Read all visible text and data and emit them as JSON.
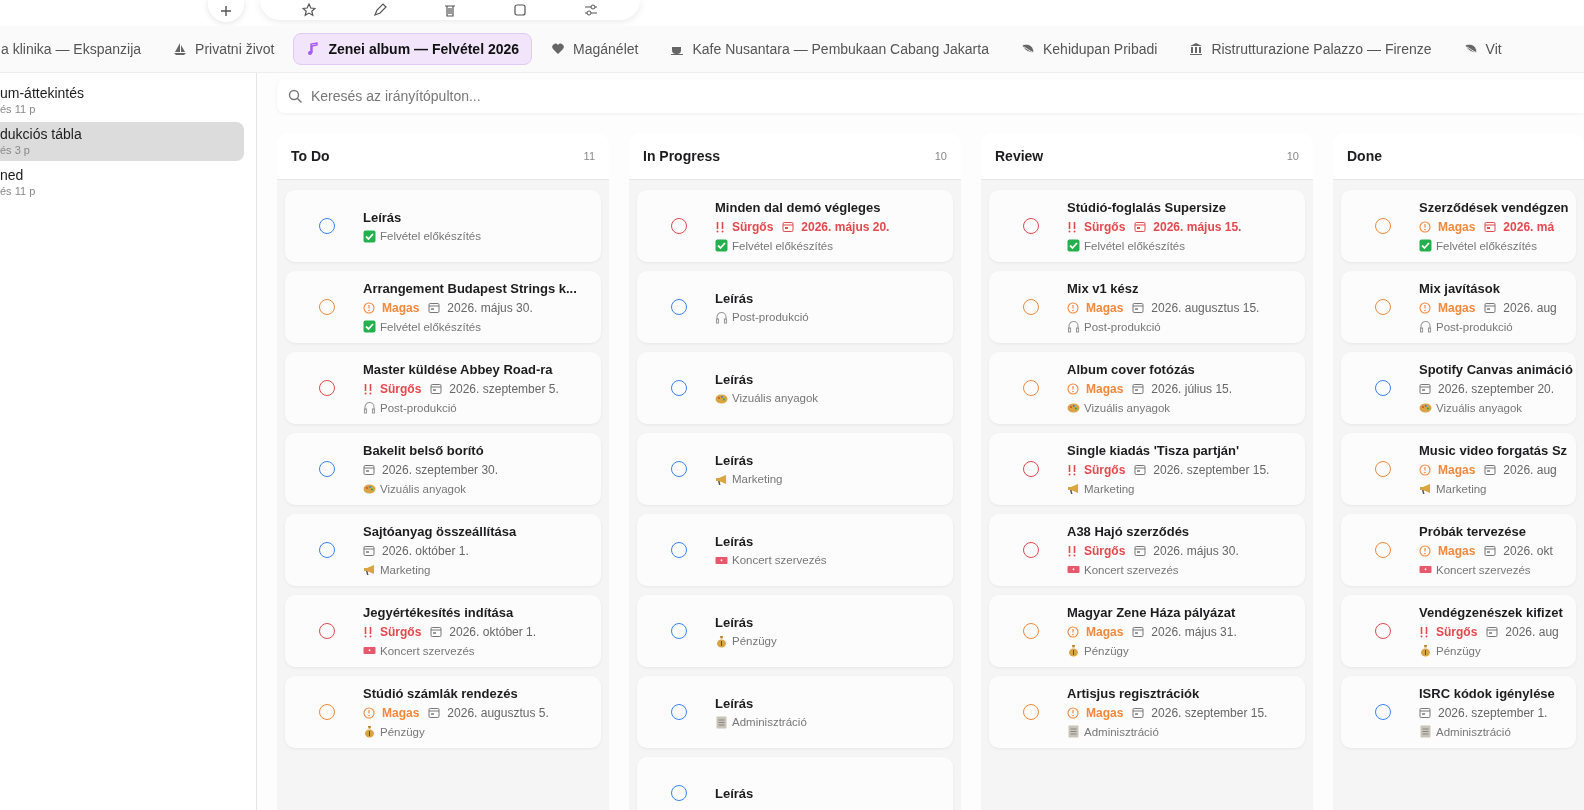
{
  "tabs": [
    {
      "label": "a klinika — Ekspanzija",
      "kind": "plain",
      "selected": false
    },
    {
      "label": "Privatni život",
      "kind": "sailboat",
      "selected": false
    },
    {
      "label": "Zenei album — Felvétel 2026",
      "kind": "note",
      "selected": true
    },
    {
      "label": "Magánélet",
      "kind": "heart",
      "selected": false
    },
    {
      "label": "Kafe Nusantara — Pembukaan Cabang Jakarta",
      "kind": "cup",
      "selected": false
    },
    {
      "label": "Kehidupan Pribadi",
      "kind": "leaf",
      "selected": false
    },
    {
      "label": "Ristrutturazione Palazzo — Firenze",
      "kind": "columns",
      "selected": false
    },
    {
      "label": "Vit",
      "kind": "leaf",
      "selected": false
    }
  ],
  "sidebar": {
    "items": [
      {
        "title": "um-áttekintés",
        "subtitle": "és 11 p",
        "selected": false
      },
      {
        "title": "dukciós tábla",
        "subtitle": "és 3 p",
        "selected": true
      },
      {
        "title": "ned",
        "subtitle": "és 11 p",
        "selected": false
      }
    ]
  },
  "search": {
    "placeholder": "Keresés az irányítópulton..."
  },
  "columns": [
    {
      "title": "To Do",
      "count": "11",
      "cards": [
        {
          "title": "Leírás",
          "kind": "none",
          "category": {
            "kind": "check",
            "label": "Felvétel előkészítés"
          }
        },
        {
          "title": "Arrangement Budapest Strings k...",
          "kind": "high",
          "priority_label": "Magas",
          "date": "2026. május 30.",
          "overdue": false,
          "category": {
            "kind": "check",
            "label": "Felvétel előkészítés"
          }
        },
        {
          "title": "Master küldése Abbey Road-ra",
          "kind": "urgent",
          "priority_label": "Sürgős",
          "date": "2026. szeptember 5.",
          "overdue": false,
          "category": {
            "kind": "headphones",
            "label": "Post-produkció"
          }
        },
        {
          "title": "Bakelit belső borító",
          "kind": "none",
          "date": "2026. szeptember 30.",
          "overdue": false,
          "category": {
            "kind": "palette",
            "label": "Vizuális anyagok"
          }
        },
        {
          "title": "Sajtóanyag összeállítása",
          "kind": "none",
          "date": "2026. október 1.",
          "overdue": false,
          "category": {
            "kind": "megaphone",
            "label": "Marketing"
          }
        },
        {
          "title": "Jegyértékesítés indítása",
          "kind": "urgent",
          "priority_label": "Sürgős",
          "date": "2026. október 1.",
          "overdue": false,
          "category": {
            "kind": "ticket",
            "label": "Koncert szervezés"
          }
        },
        {
          "title": "Stúdió számlák rendezés",
          "kind": "high",
          "priority_label": "Magas",
          "date": "2026. augusztus 5.",
          "overdue": false,
          "category": {
            "kind": "money",
            "label": "Pénzügy"
          }
        }
      ]
    },
    {
      "title": "In Progress",
      "count": "10",
      "cards": [
        {
          "title": "Minden dal demó végleges",
          "kind": "urgent",
          "priority_label": "Sürgős",
          "date": "2026. május 20.",
          "overdue": true,
          "category": {
            "kind": "check",
            "label": "Felvétel előkészítés"
          }
        },
        {
          "title": "Leírás",
          "kind": "none",
          "category": {
            "kind": "headphones",
            "label": "Post-produkció"
          }
        },
        {
          "title": "Leírás",
          "kind": "none",
          "category": {
            "kind": "palette",
            "label": "Vizuális anyagok"
          }
        },
        {
          "title": "Leírás",
          "kind": "none",
          "category": {
            "kind": "megaphone",
            "label": "Marketing"
          }
        },
        {
          "title": "Leírás",
          "kind": "none",
          "category": {
            "kind": "ticket",
            "label": "Koncert szervezés"
          }
        },
        {
          "title": "Leírás",
          "kind": "none",
          "category": {
            "kind": "money",
            "label": "Pénzügy"
          }
        },
        {
          "title": "Leírás",
          "kind": "none",
          "category": {
            "kind": "document",
            "label": "Adminisztráció"
          }
        },
        {
          "title": "Leírás",
          "kind": "none"
        }
      ]
    },
    {
      "title": "Review",
      "count": "10",
      "cards": [
        {
          "title": "Stúdió-foglalás Supersize",
          "kind": "urgent",
          "priority_label": "Sürgős",
          "date": "2026. május 15.",
          "overdue": true,
          "category": {
            "kind": "check",
            "label": "Felvétel előkészítés"
          }
        },
        {
          "title": "Mix v1 kész",
          "kind": "high",
          "priority_label": "Magas",
          "date": "2026. augusztus 15.",
          "overdue": false,
          "category": {
            "kind": "headphones",
            "label": "Post-produkció"
          }
        },
        {
          "title": "Album cover fotózás",
          "kind": "high",
          "priority_label": "Magas",
          "date": "2026. július 15.",
          "overdue": false,
          "category": {
            "kind": "palette",
            "label": "Vizuális anyagok"
          }
        },
        {
          "title": "Single kiadás 'Tisza partján'",
          "kind": "urgent",
          "priority_label": "Sürgős",
          "date": "2026. szeptember 15.",
          "overdue": false,
          "category": {
            "kind": "megaphone",
            "label": "Marketing"
          }
        },
        {
          "title": "A38 Hajó szerződés",
          "kind": "urgent",
          "priority_label": "Sürgős",
          "date": "2026. május 30.",
          "overdue": false,
          "category": {
            "kind": "ticket",
            "label": "Koncert szervezés"
          }
        },
        {
          "title": "Magyar Zene Háza pályázat",
          "kind": "high",
          "priority_label": "Magas",
          "date": "2026. május 31.",
          "overdue": false,
          "category": {
            "kind": "money",
            "label": "Pénzügy"
          }
        },
        {
          "title": "Artisjus regisztrációk",
          "kind": "high",
          "priority_label": "Magas",
          "date": "2026. szeptember 15.",
          "overdue": false,
          "category": {
            "kind": "document",
            "label": "Adminisztráció"
          }
        }
      ]
    },
    {
      "title": "Done",
      "cards": [
        {
          "title": "Szerződések vendégzen",
          "kind": "high",
          "priority_label": "Magas",
          "date": "2026. má",
          "overdue": true,
          "category": {
            "kind": "check",
            "label": "Felvétel előkészítés"
          }
        },
        {
          "title": "Mix javítások",
          "kind": "high",
          "priority_label": "Magas",
          "date": "2026. aug",
          "overdue": false,
          "category": {
            "kind": "headphones",
            "label": "Post-produkció"
          }
        },
        {
          "title": "Spotify Canvas animáció",
          "kind": "none",
          "date": "2026. szeptember 20.",
          "overdue": false,
          "category": {
            "kind": "palette",
            "label": "Vizuális anyagok"
          }
        },
        {
          "title": "Music video forgatás Sz",
          "kind": "high",
          "priority_label": "Magas",
          "date": "2026. aug",
          "overdue": false,
          "category": {
            "kind": "megaphone",
            "label": "Marketing"
          }
        },
        {
          "title": "Próbák tervezése",
          "kind": "high",
          "priority_label": "Magas",
          "date": "2026. okt",
          "overdue": false,
          "category": {
            "kind": "ticket",
            "label": "Koncert szervezés"
          }
        },
        {
          "title": "Vendégzenészek kifizet",
          "kind": "urgent",
          "priority_label": "Sürgős",
          "date": "2026. aug",
          "overdue": false,
          "category": {
            "kind": "money",
            "label": "Pénzügy"
          }
        },
        {
          "title": "ISRC kódok igénylése",
          "kind": "none",
          "date": "2026. szeptember 1.",
          "overdue": false,
          "category": {
            "kind": "document",
            "label": "Adminisztráció"
          }
        }
      ]
    }
  ]
}
